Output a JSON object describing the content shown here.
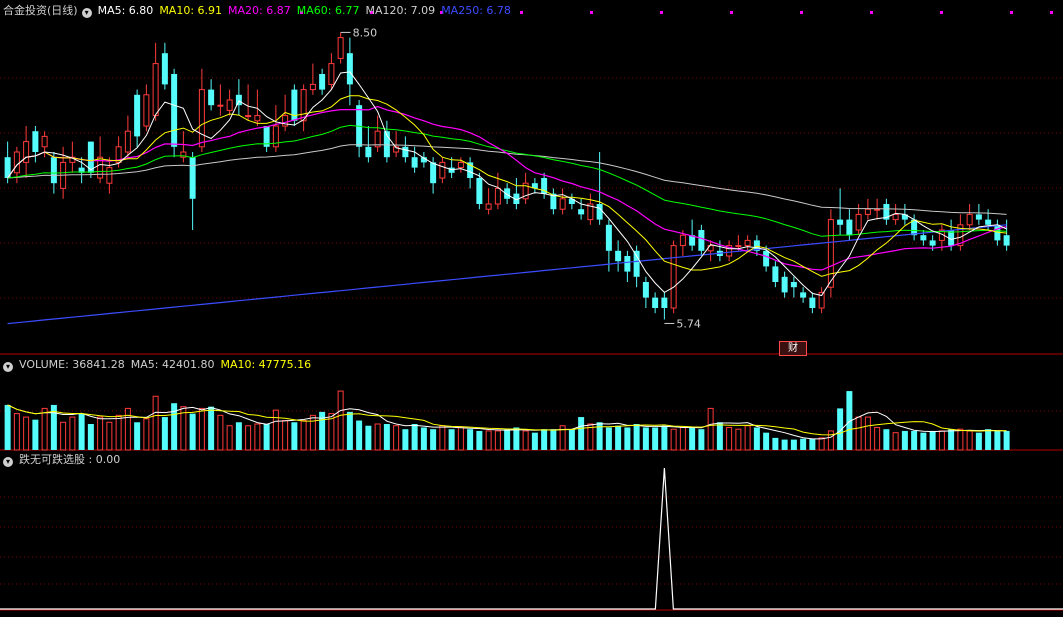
{
  "main_header": {
    "title": "合金投资(日线)",
    "ma5": "MA5: 6.80",
    "ma10": "MA10: 6.91",
    "ma20": "MA20: 6.87",
    "ma60": "MA60: 6.77",
    "ma120": "MA120: 7.09",
    "ma250": "MA250: 6.78"
  },
  "volume_header": {
    "volume": "VOLUME: 36841.28",
    "ma5": "MA5: 42401.80",
    "ma10": "MA10: 47775.16"
  },
  "indicator_header": {
    "label": "跌无可跌选股 : 0.00"
  },
  "annotations": {
    "high_label": "8.50",
    "low_label": "5.74",
    "finance_tag": "财"
  },
  "colors": {
    "up": "#ff3b3b",
    "down": "#54fcfc",
    "ma5": "#ffffff",
    "ma10": "#ffff00",
    "ma20": "#ff00ff",
    "ma60": "#00ff00",
    "ma120": "#c8c8c8",
    "ma250": "#3c4cff",
    "grid": "#7a0000"
  },
  "chart_data": [
    {
      "type": "candlestick",
      "title": "合金投资(日线)",
      "ylim": [
        5.6,
        8.6
      ],
      "high": 8.5,
      "low": 5.74,
      "candles": [
        [
          7.3,
          7.1,
          7.45,
          7.05
        ],
        [
          7.15,
          7.35,
          7.4,
          7.05
        ],
        [
          7.25,
          7.45,
          7.6,
          7.1
        ],
        [
          7.55,
          7.35,
          7.6,
          7.25
        ],
        [
          7.4,
          7.5,
          7.55,
          7.3
        ],
        [
          7.3,
          7.05,
          7.35,
          6.95
        ],
        [
          7.0,
          7.25,
          7.4,
          6.9
        ],
        [
          7.25,
          7.3,
          7.45,
          7.15
        ],
        [
          7.2,
          7.15,
          7.3,
          7.05
        ],
        [
          7.45,
          7.15,
          7.45,
          7.1
        ],
        [
          7.1,
          7.3,
          7.5,
          7.05
        ],
        [
          7.05,
          7.2,
          7.3,
          6.95
        ],
        [
          7.25,
          7.4,
          7.5,
          7.2
        ],
        [
          7.35,
          7.55,
          7.7,
          7.3
        ],
        [
          7.9,
          7.5,
          7.95,
          7.4
        ],
        [
          7.6,
          7.9,
          8.0,
          7.55
        ],
        [
          7.7,
          8.2,
          8.4,
          7.65
        ],
        [
          8.3,
          8.0,
          8.4,
          7.95
        ],
        [
          8.1,
          7.4,
          8.15,
          7.3
        ],
        [
          7.3,
          7.35,
          7.55,
          7.25
        ],
        [
          7.3,
          6.9,
          7.35,
          6.6
        ],
        [
          7.4,
          7.95,
          8.15,
          7.35
        ],
        [
          7.95,
          7.8,
          8.05,
          7.75
        ],
        [
          7.8,
          7.8,
          8.0,
          7.7
        ],
        [
          7.75,
          7.85,
          7.95,
          7.7
        ],
        [
          7.9,
          7.8,
          8.05,
          7.7
        ],
        [
          7.7,
          7.7,
          8.0,
          7.65
        ],
        [
          7.65,
          7.7,
          7.95,
          7.6
        ],
        [
          7.6,
          7.4,
          7.6,
          7.35
        ],
        [
          7.4,
          7.6,
          7.8,
          7.35
        ],
        [
          7.6,
          7.7,
          7.9,
          7.55
        ],
        [
          7.95,
          7.65,
          8.0,
          7.6
        ],
        [
          7.65,
          7.95,
          8.0,
          7.55
        ],
        [
          7.95,
          8.0,
          8.2,
          7.9
        ],
        [
          8.1,
          7.95,
          8.15,
          7.9
        ],
        [
          8.0,
          8.2,
          8.3,
          7.95
        ],
        [
          8.25,
          8.45,
          8.5,
          8.2
        ],
        [
          8.3,
          8.0,
          8.45,
          7.8
        ],
        [
          7.8,
          7.4,
          7.85,
          7.3
        ],
        [
          7.4,
          7.3,
          7.6,
          7.25
        ],
        [
          7.4,
          7.55,
          7.7,
          7.35
        ],
        [
          7.55,
          7.3,
          7.65,
          7.25
        ],
        [
          7.35,
          7.4,
          7.55,
          7.3
        ],
        [
          7.4,
          7.3,
          7.5,
          7.25
        ],
        [
          7.3,
          7.2,
          7.4,
          7.15
        ],
        [
          7.3,
          7.25,
          7.35,
          7.2
        ],
        [
          7.25,
          7.05,
          7.3,
          6.95
        ],
        [
          7.1,
          7.25,
          7.3,
          7.05
        ],
        [
          7.2,
          7.15,
          7.3,
          7.1
        ],
        [
          7.2,
          7.25,
          7.3,
          7.15
        ],
        [
          7.25,
          7.1,
          7.3,
          7.0
        ],
        [
          7.1,
          6.85,
          7.15,
          6.8
        ],
        [
          6.8,
          6.85,
          7.0,
          6.75
        ],
        [
          6.85,
          7.0,
          7.15,
          6.8
        ],
        [
          7.0,
          6.9,
          7.05,
          6.85
        ],
        [
          6.95,
          6.85,
          7.1,
          6.8
        ],
        [
          6.9,
          7.05,
          7.15,
          6.85
        ],
        [
          7.05,
          7.0,
          7.1,
          6.95
        ],
        [
          7.1,
          6.95,
          7.15,
          6.9
        ],
        [
          6.95,
          6.8,
          7.0,
          6.75
        ],
        [
          6.8,
          6.9,
          7.0,
          6.75
        ],
        [
          6.9,
          6.85,
          6.95,
          6.8
        ],
        [
          6.8,
          6.75,
          6.9,
          6.7
        ],
        [
          6.7,
          6.85,
          6.95,
          6.65
        ],
        [
          6.85,
          6.7,
          7.35,
          6.65
        ],
        [
          6.65,
          6.4,
          6.7,
          6.2
        ],
        [
          6.4,
          6.3,
          6.5,
          6.2
        ],
        [
          6.35,
          6.2,
          6.4,
          6.1
        ],
        [
          6.4,
          6.15,
          6.45,
          6.05
        ],
        [
          6.1,
          5.95,
          6.15,
          5.85
        ],
        [
          5.95,
          5.85,
          6.0,
          5.8
        ],
        [
          5.95,
          5.85,
          6.0,
          5.74
        ],
        [
          5.85,
          6.45,
          6.5,
          5.8
        ],
        [
          6.45,
          6.55,
          6.6,
          6.35
        ],
        [
          6.55,
          6.45,
          6.7,
          6.4
        ],
        [
          6.6,
          6.4,
          6.65,
          6.35
        ],
        [
          6.4,
          6.45,
          6.5,
          6.3
        ],
        [
          6.4,
          6.35,
          6.5,
          6.3
        ],
        [
          6.35,
          6.45,
          6.5,
          6.3
        ],
        [
          6.45,
          6.45,
          6.55,
          6.4
        ],
        [
          6.45,
          6.5,
          6.55,
          6.4
        ],
        [
          6.5,
          6.4,
          6.55,
          6.35
        ],
        [
          6.4,
          6.25,
          6.45,
          6.2
        ],
        [
          6.25,
          6.1,
          6.3,
          6.05
        ],
        [
          6.15,
          6.0,
          6.2,
          5.95
        ],
        [
          6.1,
          6.05,
          6.15,
          5.95
        ],
        [
          6.0,
          5.95,
          6.05,
          5.9
        ],
        [
          5.95,
          5.85,
          6.0,
          5.8
        ],
        [
          5.85,
          6.0,
          6.05,
          5.8
        ],
        [
          6.05,
          6.7,
          6.8,
          5.95
        ],
        [
          6.7,
          6.65,
          7.0,
          6.55
        ],
        [
          6.7,
          6.55,
          6.8,
          6.5
        ],
        [
          6.6,
          6.75,
          6.85,
          6.55
        ],
        [
          6.75,
          6.8,
          6.9,
          6.7
        ],
        [
          6.8,
          6.8,
          6.9,
          6.7
        ],
        [
          6.85,
          6.7,
          6.9,
          6.65
        ],
        [
          6.7,
          6.75,
          6.85,
          6.65
        ],
        [
          6.75,
          6.7,
          6.85,
          6.65
        ],
        [
          6.7,
          6.55,
          6.75,
          6.5
        ],
        [
          6.55,
          6.5,
          6.6,
          6.45
        ],
        [
          6.5,
          6.45,
          6.55,
          6.4
        ],
        [
          6.5,
          6.6,
          6.65,
          6.4
        ],
        [
          6.6,
          6.45,
          6.7,
          6.4
        ],
        [
          6.45,
          6.65,
          6.75,
          6.4
        ],
        [
          6.65,
          6.75,
          6.85,
          6.6
        ],
        [
          6.75,
          6.7,
          6.85,
          6.65
        ],
        [
          6.7,
          6.65,
          6.8,
          6.6
        ],
        [
          6.65,
          6.5,
          6.7,
          6.45
        ],
        [
          6.55,
          6.45,
          6.7,
          6.4
        ]
      ]
    },
    {
      "type": "bar",
      "title": "VOLUME",
      "ylim": [
        0,
        90000
      ],
      "values": [
        52000,
        42000,
        38000,
        35000,
        48000,
        52000,
        32000,
        38000,
        42000,
        30000,
        38000,
        32000,
        40000,
        48000,
        32000,
        36000,
        62000,
        38000,
        54000,
        50000,
        42000,
        48000,
        50000,
        40000,
        28000,
        32000,
        28000,
        30000,
        30000,
        46000,
        34000,
        32000,
        34000,
        40000,
        44000,
        42000,
        68000,
        44000,
        34000,
        28000,
        30000,
        30000,
        28000,
        24000,
        30000,
        26000,
        24000,
        28000,
        24000,
        26000,
        24000,
        22000,
        22000,
        22000,
        24000,
        26000,
        22000,
        20000,
        24000,
        24000,
        28000,
        24000,
        38000,
        30000,
        32000,
        26000,
        28000,
        26000,
        30000,
        26000,
        26000,
        28000,
        24000,
        26000,
        26000,
        24000,
        48000,
        32000,
        26000,
        24000,
        28000,
        26000,
        20000,
        14000,
        12000,
        12000,
        13000,
        13000,
        14000,
        22000,
        48000,
        68000,
        38000,
        38000,
        26000,
        24000,
        20000,
        22000,
        22000,
        20000,
        22000,
        22000,
        24000,
        24000,
        22000,
        20000,
        24000,
        22000,
        22000
      ]
    },
    {
      "type": "line",
      "title": "跌无可跌选股",
      "value": 0.0,
      "signal_at_candle": 71
    }
  ]
}
